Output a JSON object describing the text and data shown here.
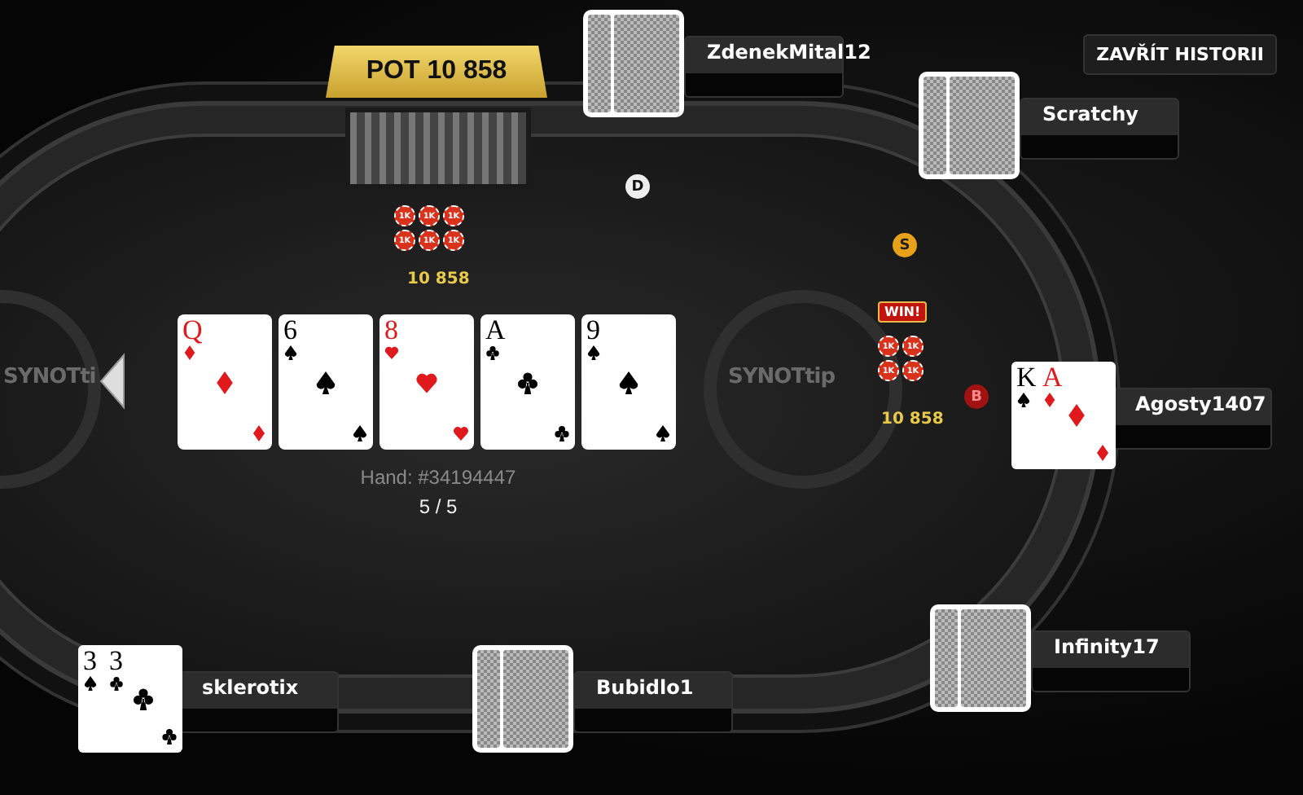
{
  "pot": {
    "label": "POT 10 858"
  },
  "close_history_button": {
    "label": "ZAVŘÍT HISTORII"
  },
  "table_logos": [
    "SYNOTti",
    "SYNOTtip"
  ],
  "center_pot": {
    "chips": [
      "1K",
      "1K",
      "1K",
      "1K",
      "1K",
      "1K"
    ],
    "amount": "10 858"
  },
  "markers": [
    {
      "kind": "dealer",
      "label": "D"
    },
    {
      "kind": "small",
      "label": "S"
    },
    {
      "kind": "big",
      "label": "B"
    }
  ],
  "board": [
    {
      "rank": "Q",
      "kind": "diamonds"
    },
    {
      "rank": "6",
      "kind": "spades"
    },
    {
      "rank": "8",
      "kind": "hearts"
    },
    {
      "rank": "A",
      "kind": "clubs"
    },
    {
      "rank": "9",
      "kind": "spades"
    }
  ],
  "hand_info": {
    "hand": "Hand: #34194447",
    "step": "5 / 5"
  },
  "players": [
    {
      "name": "ZdenekMital12"
    },
    {
      "name": "Scratchy"
    },
    {
      "name": "Agosty1407",
      "cards": [
        {
          "rank": "K",
          "kind": "spades"
        },
        {
          "rank": "A",
          "kind": "diamonds"
        }
      ],
      "win": {
        "badge": "WIN!",
        "chips": [
          "1K",
          "1K",
          "1K",
          "1K"
        ],
        "amount": "10 858"
      }
    },
    {
      "name": "Infinity17"
    },
    {
      "name": "Bubidlo1"
    },
    {
      "name": "sklerotix",
      "cards": [
        {
          "rank": "3",
          "kind": "spades"
        },
        {
          "rank": "3",
          "kind": "clubs"
        }
      ]
    }
  ]
}
